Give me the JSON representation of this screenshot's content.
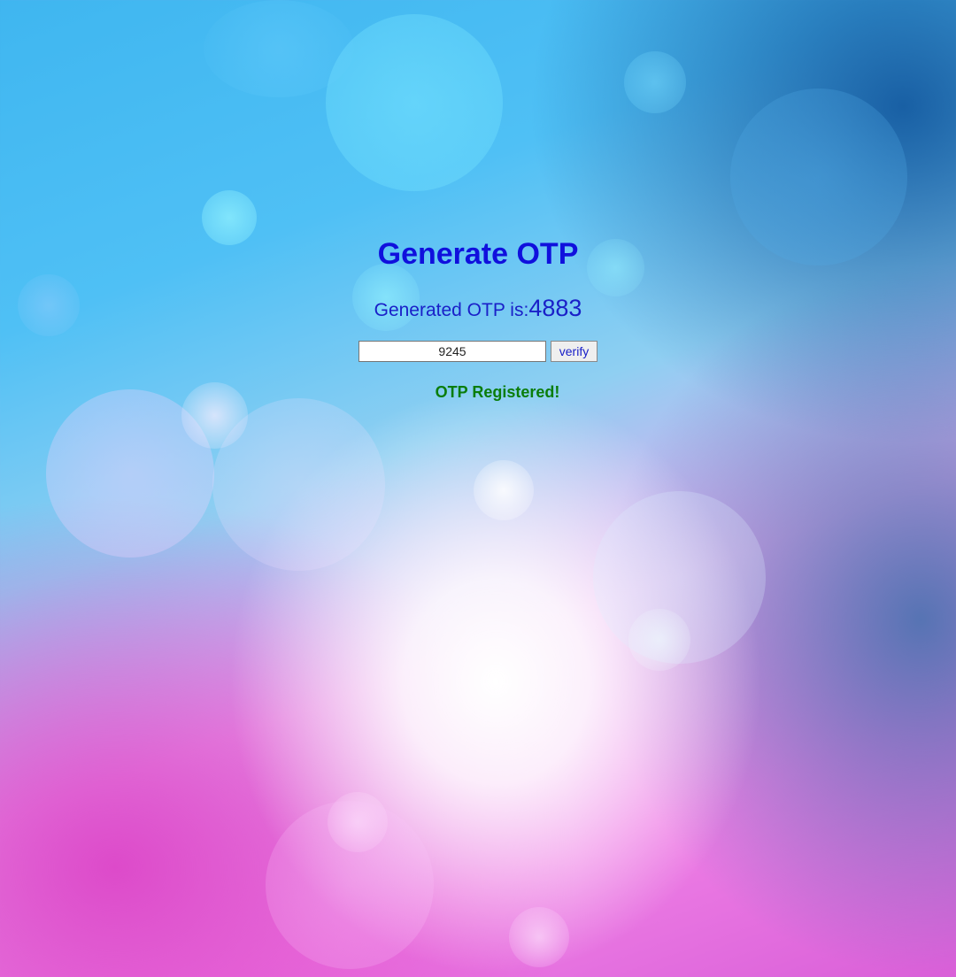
{
  "page": {
    "title": "Generate OTP"
  },
  "otp": {
    "label": "Generated OTP is:",
    "value": "4883"
  },
  "form": {
    "input_value": "9245",
    "verify_label": "verify"
  },
  "status": {
    "message": "OTP Registered!"
  },
  "colors": {
    "title": "#1010dd",
    "text": "#1a20c8",
    "success": "#0a7d0a"
  }
}
